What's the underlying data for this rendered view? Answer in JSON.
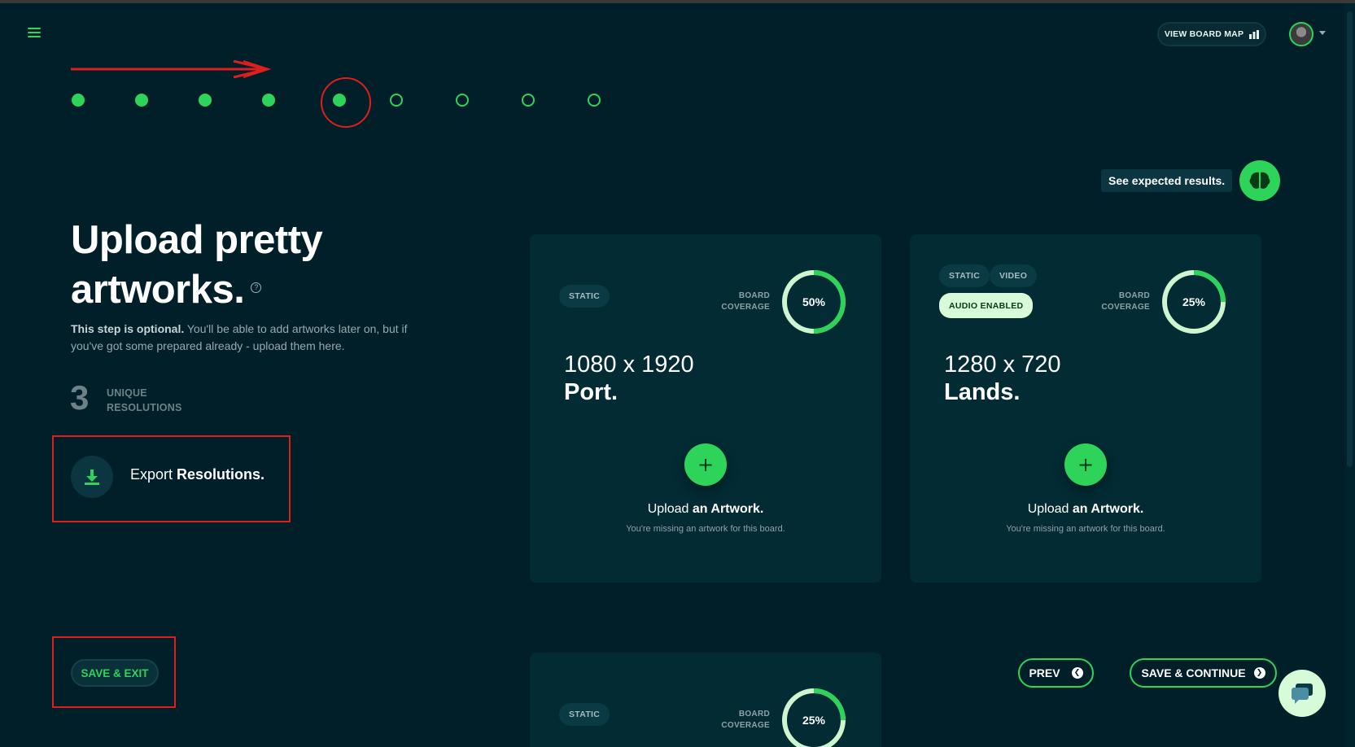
{
  "header": {
    "menu_icon": "hamburger-icon",
    "board_map_label": "VIEW BOARD MAP",
    "board_map_icon": "board-map-icon",
    "avatar_icon": "user-avatar"
  },
  "steps": {
    "total": 9,
    "completed": 5,
    "current": 5
  },
  "hint": {
    "label": "See expected results.",
    "icon": "brain-icon"
  },
  "intro": {
    "title_line1": "Upload pretty",
    "title_line2": "artworks.",
    "help_glyph": "?",
    "desc_bold": "This step is optional.",
    "desc_rest": " You'll be able to add artworks later on, but if you've got some prepared already - upload them here."
  },
  "stats": {
    "count": "3",
    "label_line1": "UNIQUE",
    "label_line2": "RESOLUTIONS"
  },
  "export": {
    "label_regular": "Export ",
    "label_bold": "Resolutions.",
    "icon": "download-icon"
  },
  "actions": {
    "save_exit": "SAVE & EXIT",
    "prev": "PREV",
    "save_continue": "SAVE & CONTINUE",
    "chat_icon": "chat-icon"
  },
  "cards": [
    {
      "tags": [
        "STATIC"
      ],
      "coverage_label_1": "BOARD",
      "coverage_label_2": "COVERAGE",
      "coverage_text": "50%",
      "coverage_value": 0.5,
      "dims": "1080 x 1920",
      "orientation": "Port.",
      "upload_regular": "Upload ",
      "upload_bold": "an Artwork.",
      "upload_sub": "You're missing an artwork for this board."
    },
    {
      "tags": [
        "STATIC",
        "VIDEO"
      ],
      "audio_tag": "AUDIO ENABLED",
      "coverage_label_1": "BOARD",
      "coverage_label_2": "COVERAGE",
      "coverage_text": "25%",
      "coverage_value": 0.25,
      "dims": "1280 x 720",
      "orientation": "Lands.",
      "upload_regular": "Upload ",
      "upload_bold": "an Artwork.",
      "upload_sub": "You're missing an artwork for this board."
    },
    {
      "tags": [
        "STATIC"
      ],
      "coverage_label_1": "BOARD",
      "coverage_label_2": "COVERAGE",
      "coverage_text": "25%",
      "coverage_value": 0.25
    }
  ],
  "colors": {
    "background": "#011f29",
    "card": "#022b33",
    "accent": "#2ed35a",
    "accent_light": "#d7fbd9",
    "annotation": "#e01e1e"
  }
}
